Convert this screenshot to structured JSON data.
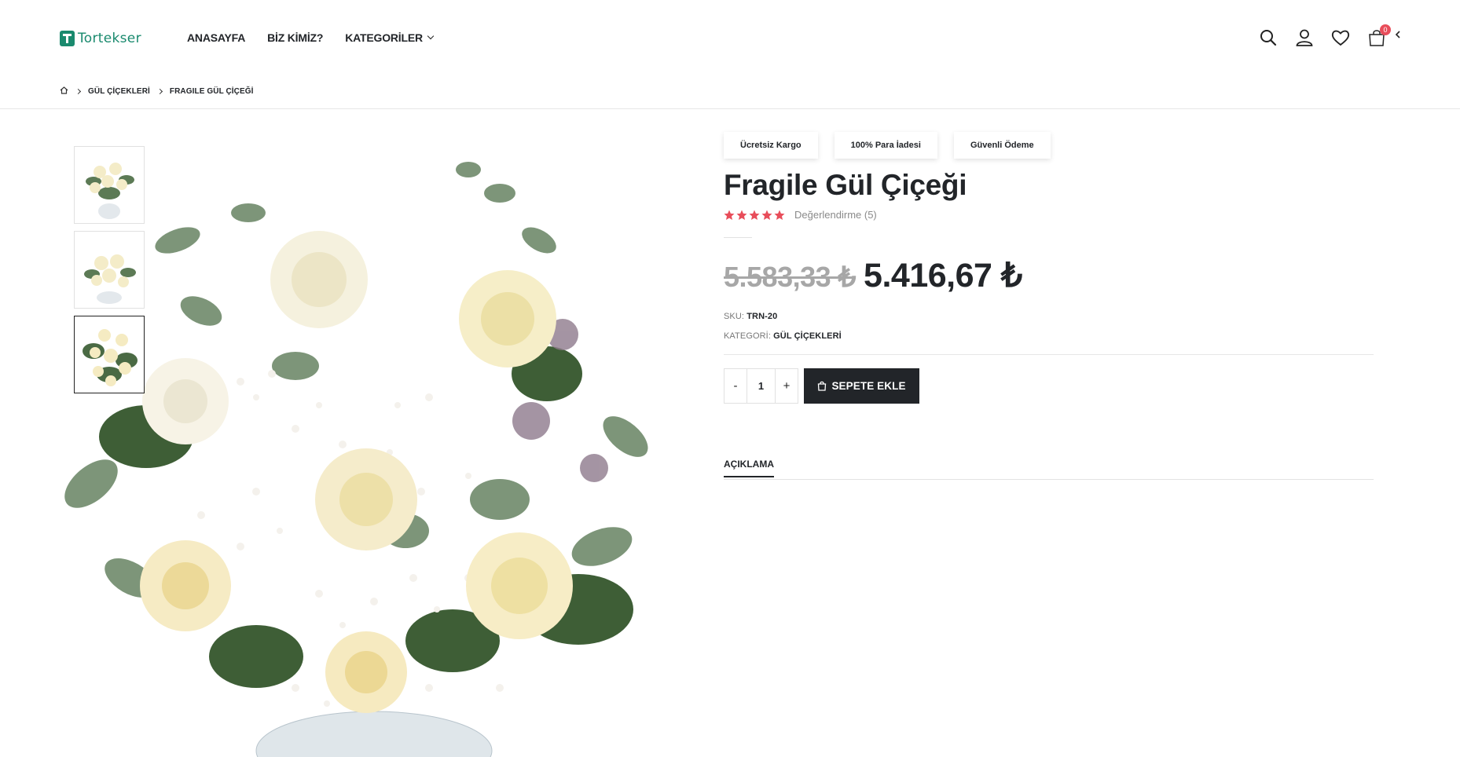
{
  "header": {
    "logo_text": "Tortekser",
    "nav": [
      {
        "label": "ANASAYFA"
      },
      {
        "label": "BİZ KİMİZ?"
      },
      {
        "label": "KATEGORİLER"
      }
    ],
    "cart_count": "0",
    "icons": [
      "search-icon",
      "user-icon",
      "heart-icon",
      "cart-icon",
      "chevron-left-icon"
    ]
  },
  "breadcrumb": {
    "items": [
      "GÜL ÇİÇEKLERİ",
      "FRAGILE GÜL ÇİÇEĞİ"
    ]
  },
  "product": {
    "badges": [
      "Ücretsiz Kargo",
      "100% Para İadesi",
      "Güvenli Ödeme"
    ],
    "title": "Fragile Gül Çiçeği",
    "rating_stars": 5,
    "rating_text": "Değerlendirme (5)",
    "old_price": "5.583,33 ₺",
    "new_price": "5.416,67 ₺",
    "sku_label": "SKU:",
    "sku_value": "TRN-20",
    "category_label": "KATEGORİ:",
    "category_value": "GÜL ÇİÇEKLERİ",
    "quantity": "1",
    "qty_minus": "-",
    "qty_plus": "+",
    "add_to_cart": "SEPETE EKLE",
    "tab_description": "AÇIKLAMA"
  },
  "colors": {
    "brand": "#1a8a6e",
    "dark": "#222529",
    "star": "#e84d5a",
    "badge": "#e84d5a"
  }
}
